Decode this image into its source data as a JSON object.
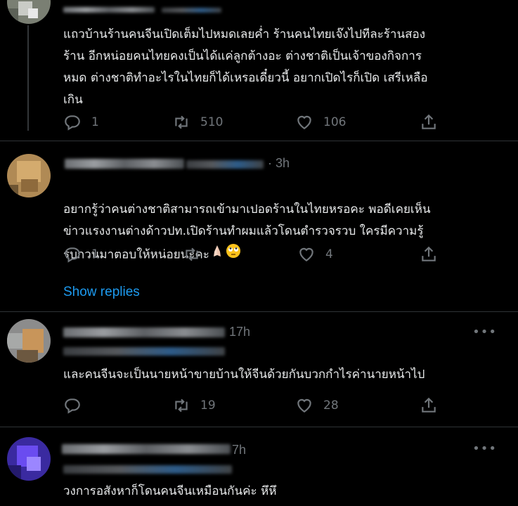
{
  "tweets": [
    {
      "time": "",
      "text": "แถวบ้านร้านคนจีนเปิดเต็มไปหมดเลยค่ำ ร้านคนไทยเจ๊งไปทีละร้านสอง\nร้าน อีกหน่อยคนไทยคงเป็นได้แค่ลูกต้างอะ ต่างชาติเป็นเจ้าของกิจการ\nหมด ต่างชาติทำอะไรในไทยก็ได้เหรอเดี๋ยวนี้ อยากเปิดไรก็เปิด เสรีเหลือ\nเกิน",
      "replies": "1",
      "retweets": "510",
      "likes": "106"
    },
    {
      "time": "· 3h",
      "text": "อยากรู้ว่าคนต่างชาติสามารถเข้ามาเปอดร้านในไทยหรอคะ พอดีเคยเห็น\nข่าวแรงงานต่างด้าวปท.เปิดร้านทำผมแล้วโดนตำรวจรวบ ใครมีความรู้\nรบกวนมาตอบให้หน่อยนะคะ",
      "replies": "1",
      "retweets": "",
      "likes": "4"
    },
    {
      "time": "17h",
      "text": "และคนจีนจะเป็นนายหน้าขายบ้านให้จีนด้วยกันบวกกำไรค่านายหน้าไป",
      "replies": "",
      "retweets": "19",
      "likes": "28"
    },
    {
      "time": "7h",
      "text": "วงการอสังหาก็โดนคนจีนเหมือนกันค่ะ หึหึ",
      "replies": "",
      "retweets": "",
      "likes": ""
    }
  ],
  "show_replies": "Show replies",
  "more_glyph": "•••",
  "icons": [
    "reply-icon",
    "retweet-icon",
    "like-icon",
    "share-icon",
    "more-icon"
  ],
  "colors": {
    "background": "#000000",
    "text": "#e7e9ea",
    "muted": "#71767b",
    "link": "#1d9bf0",
    "divider": "#2f3336"
  }
}
